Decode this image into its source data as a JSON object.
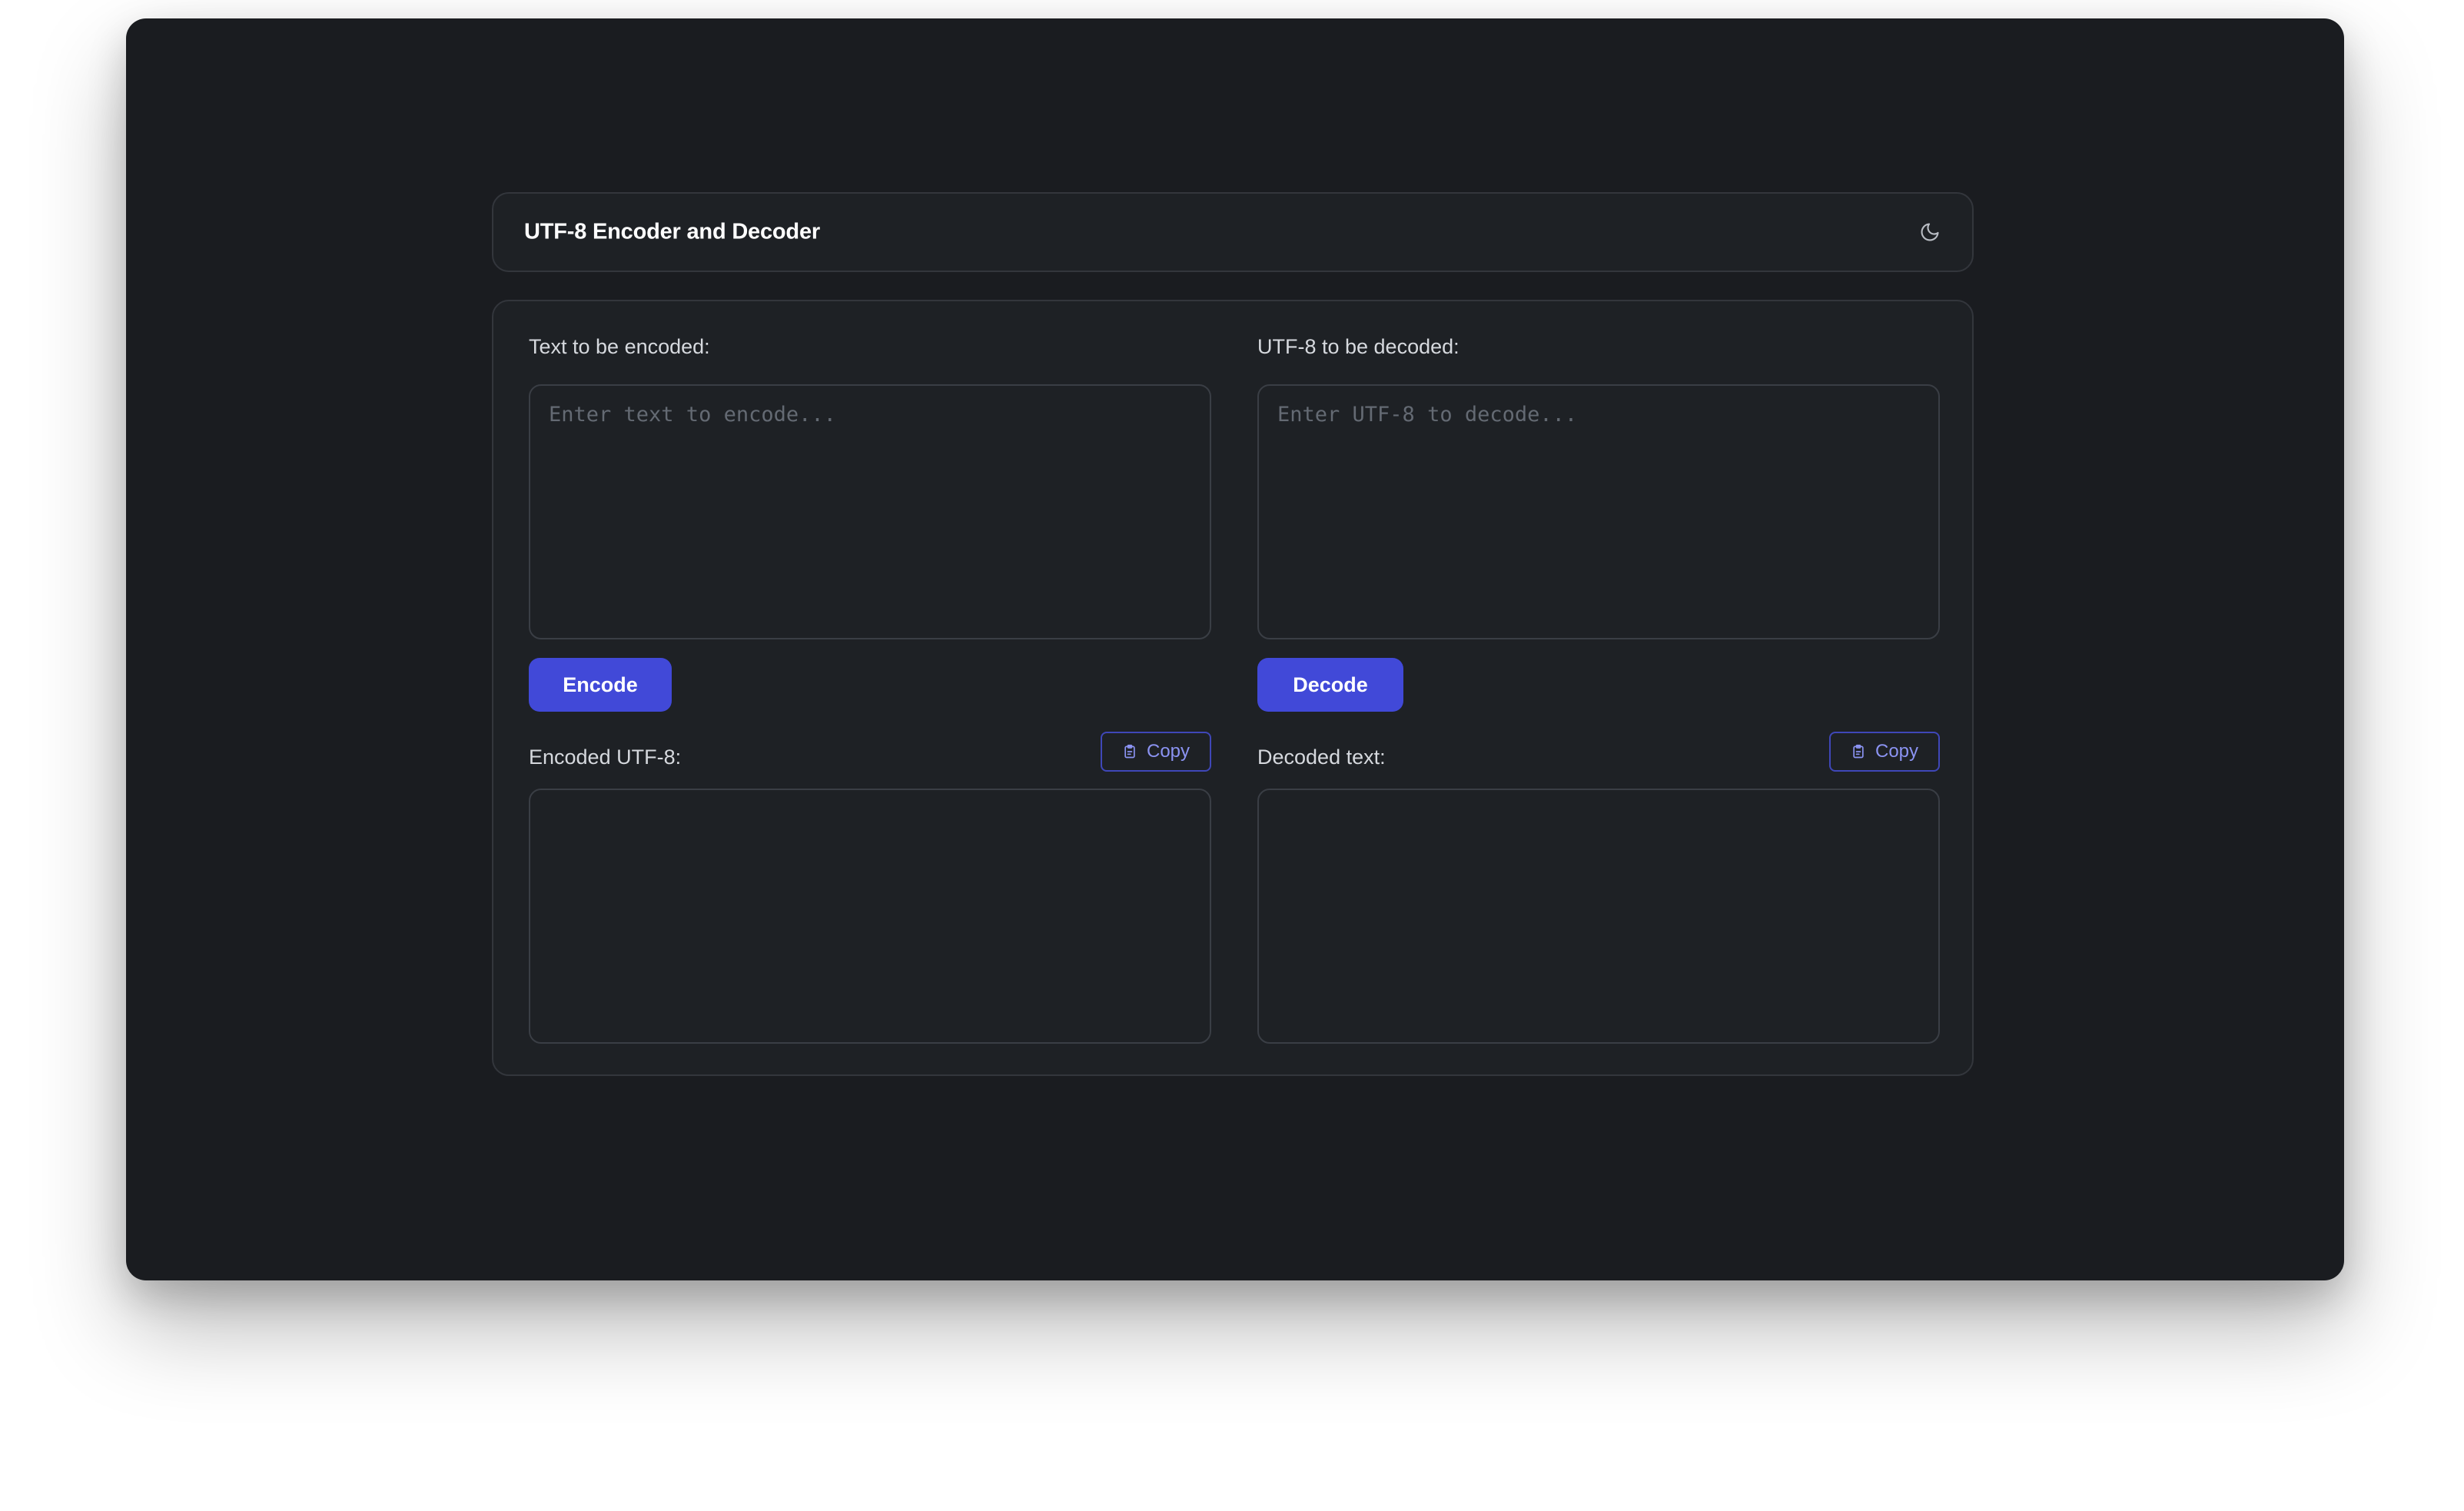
{
  "header": {
    "title": "UTF-8 Encoder and Decoder",
    "theme_icon": "moon-icon"
  },
  "encoder": {
    "input_label": "Text to be encoded:",
    "input_placeholder": "Enter text to encode...",
    "input_value": "",
    "button_label": "Encode",
    "output_label": "Encoded UTF-8:",
    "output_value": "",
    "copy_label": "Copy",
    "copy_icon": "clipboard-icon"
  },
  "decoder": {
    "input_label": "UTF-8 to be decoded:",
    "input_placeholder": "Enter UTF-8 to decode...",
    "input_value": "",
    "button_label": "Decode",
    "output_label": "Decoded text:",
    "output_value": "",
    "copy_label": "Copy",
    "copy_icon": "clipboard-icon"
  },
  "colors": {
    "background": "#1a1c20",
    "card": "#1e2125",
    "accent": "#4149d8",
    "accent_text": "#8b93f2"
  }
}
